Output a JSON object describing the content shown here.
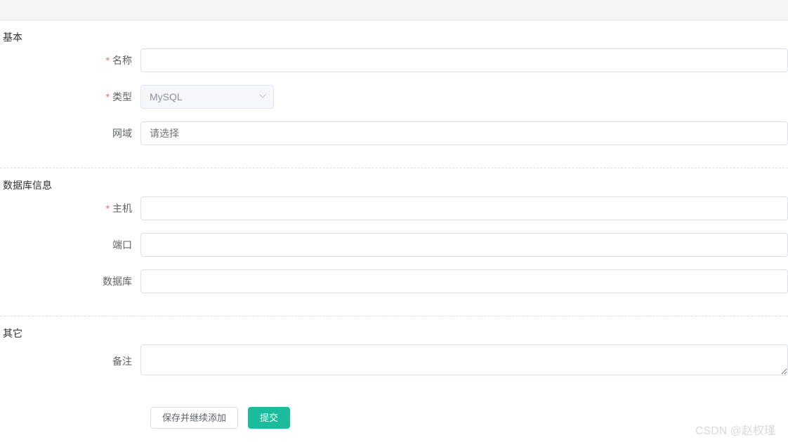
{
  "sections": {
    "basic": {
      "title": "基本",
      "fields": {
        "name": {
          "label": "名称",
          "value": ""
        },
        "type": {
          "label": "类型",
          "value": "MySQL"
        },
        "domain": {
          "label": "网域",
          "placeholder": "请选择"
        }
      }
    },
    "database": {
      "title": "数据库信息",
      "fields": {
        "host": {
          "label": "主机",
          "value": ""
        },
        "port": {
          "label": "端口",
          "value": ""
        },
        "dbname": {
          "label": "数据库",
          "value": ""
        }
      }
    },
    "other": {
      "title": "其它",
      "fields": {
        "remark": {
          "label": "备注",
          "value": ""
        }
      }
    }
  },
  "buttons": {
    "save_continue": "保存并继续添加",
    "submit": "提交"
  },
  "watermark": "CSDN @赵权瑾"
}
